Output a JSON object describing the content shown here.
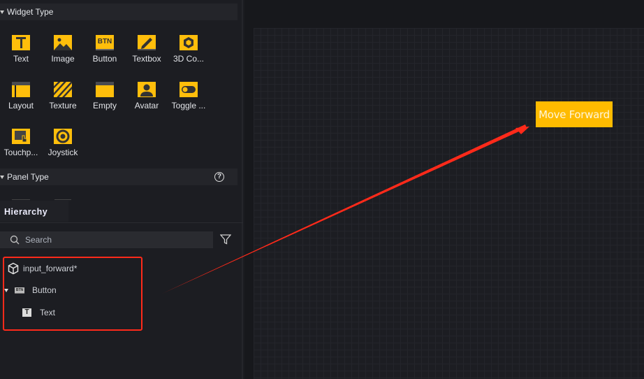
{
  "widget_panel": {
    "title": "Widget Type",
    "items": [
      {
        "label": "Text",
        "icon": "text-icon"
      },
      {
        "label": "Image",
        "icon": "image-icon"
      },
      {
        "label": "Button",
        "icon": "button-icon",
        "glyph": "BTN"
      },
      {
        "label": "Textbox",
        "icon": "pencil-icon"
      },
      {
        "label": "3D Co...",
        "icon": "cube-icon"
      },
      {
        "label": "Layout",
        "icon": "layout-icon"
      },
      {
        "label": "Texture",
        "icon": "texture-icon"
      },
      {
        "label": "Empty",
        "icon": "empty-icon"
      },
      {
        "label": "Avatar",
        "icon": "avatar-icon"
      },
      {
        "label": "Toggle ...",
        "icon": "toggle-icon"
      },
      {
        "label": "Touchp...",
        "icon": "touchpad-icon"
      },
      {
        "label": "Joystick",
        "icon": "joystick-icon"
      }
    ]
  },
  "panel_type": {
    "title": "Panel Type"
  },
  "hierarchy": {
    "tab": "Hierarchy",
    "search_placeholder": "Search",
    "tree": [
      {
        "label": "input_forward*"
      },
      {
        "label": "Button"
      },
      {
        "label": "Text"
      }
    ]
  },
  "canvas": {
    "button_label": "Move Forward"
  },
  "colors": {
    "accent": "#ffbb00",
    "annotation": "#ff2a1a"
  }
}
